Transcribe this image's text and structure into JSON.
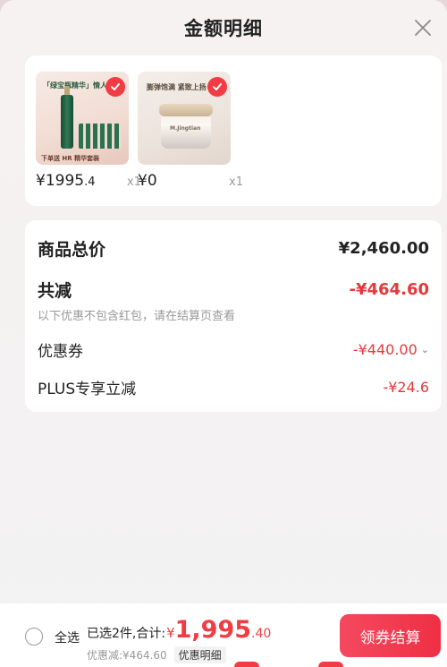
{
  "header": {
    "title": "金额明细"
  },
  "products": [
    {
      "price_int": "¥1995",
      "price_dec": ".4",
      "qty": "x1",
      "thumb_text_top": "「绿宝瓶精华」情人节",
      "thumb_text_bottom": "下单送 HR 精华套装"
    },
    {
      "price_int": "¥0",
      "price_dec": "",
      "qty": "x1",
      "thumb_text_top": "膨弹饱满 紧致上扬",
      "thumb_text_bottom": "M.Jingtian"
    }
  ],
  "summary": {
    "total_label": "商品总价",
    "total_value": "¥2,460.00",
    "reduce_label": "共减",
    "reduce_value": "-¥464.60",
    "note": "以下优惠不包含红包，请在结算页查看",
    "coupon_label": "优惠券",
    "coupon_value": "-¥440.00",
    "plus_label": "PLUS专享立减",
    "plus_value": "-¥24.6"
  },
  "bottom": {
    "select_all": "全选",
    "selected_text": "已选2件,合计:",
    "currency": "¥",
    "amount_int": "1,995",
    "amount_dec": ".40",
    "discount_text": "优惠减:¥464.60",
    "detail_label": "优惠明细",
    "checkout_label": "领券结算"
  },
  "colors": {
    "accent": "#f23b43",
    "price_red": "#e4393c",
    "text_dark": "#222222",
    "text_muted": "#999999"
  },
  "icons": [
    "close-icon",
    "check-icon",
    "radio-icon",
    "chevron-down-icon"
  ]
}
